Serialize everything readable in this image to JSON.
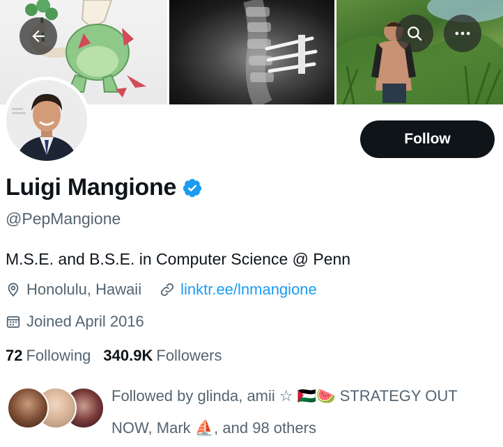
{
  "profile": {
    "display_name": "Luigi Mangione",
    "verified": true,
    "handle": "@PepMangione",
    "bio": "M.S.E. and B.S.E. in Computer Science @ Penn",
    "location": "Honolulu, Hawaii",
    "website": "linktr.ee/lnmangione",
    "joined": "Joined April 2016"
  },
  "actions": {
    "follow_label": "Follow"
  },
  "stats": {
    "following_count": "72",
    "following_label": "Following",
    "followers_count": "340.9K",
    "followers_label": "Followers"
  },
  "followed_by": {
    "line1": "Followed by glinda, amii ☆ 🇵🇸🍉 STRATEGY OUT",
    "line2": "NOW, Mark ⛵, and 98 others"
  },
  "icons": {
    "back": "arrow-left-icon",
    "search": "search-icon",
    "more": "more-horizontal-icon",
    "verified": "verified-badge-icon",
    "location": "location-pin-icon",
    "link": "link-icon",
    "calendar": "calendar-icon"
  },
  "colors": {
    "accent": "#1d9bf0",
    "text_primary": "#0f1419",
    "text_secondary": "#536471",
    "follow_button_bg": "#0f1419"
  }
}
